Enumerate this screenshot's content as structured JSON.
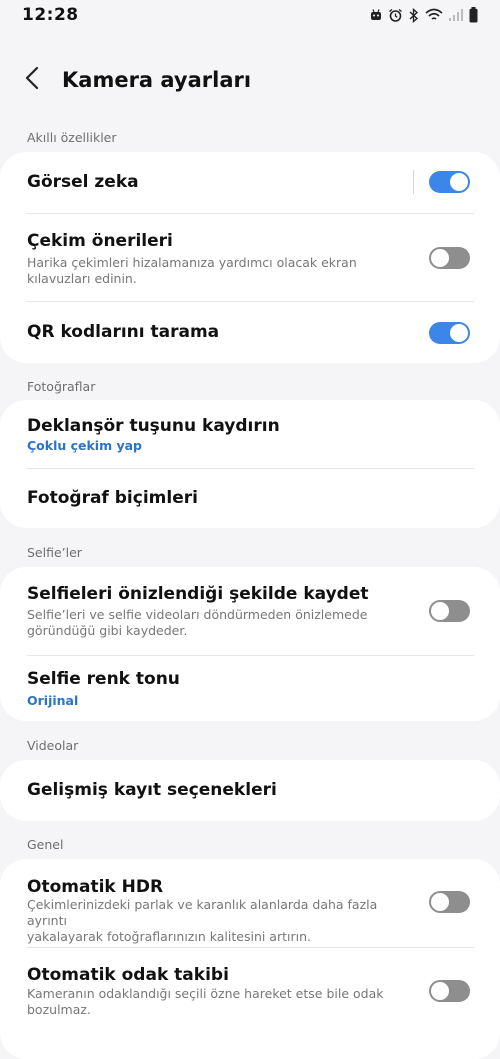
{
  "status_bar": {
    "time": "12:28"
  },
  "header": {
    "title": "Kamera ayarları"
  },
  "sections": {
    "smart": {
      "label": "Akıllı özellikler",
      "visual_intelligence": {
        "title": "Görsel zeka",
        "enabled": true
      },
      "shot_suggestions": {
        "title": "Çekim önerileri",
        "description_line1": "Harika çekimleri hizalamanıza yardımcı olacak ekran",
        "description_line2": "kılavuzları edinin.",
        "enabled": false
      },
      "qr_scan": {
        "title": "QR kodlarını tarama",
        "enabled": true
      }
    },
    "photos": {
      "label": "Fotoğraflar",
      "shutter_swipe": {
        "title": "Deklanşör tuşunu kaydırın",
        "value": "Çoklu çekim yap"
      },
      "photo_formats": {
        "title": "Fotoğraf biçimleri"
      }
    },
    "selfies": {
      "label": "Selfie’ler",
      "save_as_previewed": {
        "title": "Selfieleri önizlendiği şekilde kaydet",
        "description_line1": "Selfie’leri ve selfie videoları döndürmeden önizlemede",
        "description_line2": "göründüğü gibi kaydeder.",
        "enabled": false
      },
      "selfie_tone": {
        "title": "Selfie renk tonu",
        "value": "Orijinal"
      }
    },
    "videos": {
      "label": "Videolar",
      "advanced_recording": {
        "title": "Gelişmiş kayıt seçenekleri"
      }
    },
    "general": {
      "label": "Genel",
      "auto_hdr": {
        "title": "Otomatik HDR",
        "description_line1": "Çekimlerinizdeki parlak ve karanlık alanlarda daha fazla ayrıntı",
        "description_line2": "yakalayarak fotoğraflarınızın kalitesini artırın.",
        "enabled": false
      },
      "tracking_af": {
        "title": "Otomatik odak takibi",
        "description_line1": "Kameranın odaklandığı seçili özne hareket etse bile odak",
        "description_line2": "bozulmaz.",
        "enabled": false
      }
    }
  },
  "colors": {
    "accent": "#3b86e8",
    "link": "#2a73c9",
    "toggle_off": "#8e8e8e",
    "background": "#f5f5f7",
    "card": "#ffffff"
  },
  "icons": {
    "back": "chevron-left-icon",
    "status": [
      "android-icon",
      "alarm-icon",
      "bluetooth-icon",
      "wifi-icon",
      "signal-icon",
      "battery-icon"
    ]
  }
}
